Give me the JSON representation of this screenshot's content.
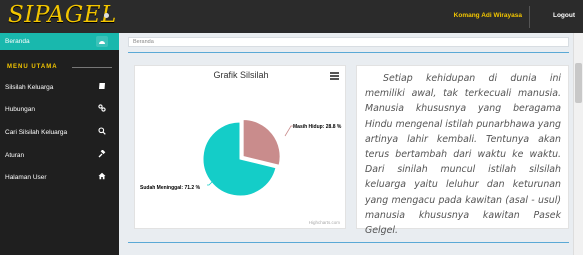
{
  "header": {
    "brand": "SIPAGEL",
    "user_name": "Komang Adi Wirayasa",
    "logout_label": "Logout"
  },
  "sidebar": {
    "active_item": {
      "label": "Beranda",
      "icon": "dashboard-icon"
    },
    "menu_title": "MENU UTAMA",
    "items": [
      {
        "label": "Silsilah Keluarga",
        "icon": "book-icon"
      },
      {
        "label": "Hubungan",
        "icon": "link-icon"
      },
      {
        "label": "Cari Silsilah Keluarga",
        "icon": "search-icon"
      },
      {
        "label": "Aturan",
        "icon": "gavel-icon"
      },
      {
        "label": "Halaman User",
        "icon": "home-icon"
      }
    ]
  },
  "breadcrumb": "Beranda",
  "chart_data": {
    "type": "pie",
    "title": "Grafik Silsilah",
    "series": [
      {
        "name": "Masih Hidup",
        "value": 28.8,
        "label": "Masih Hidup: 28.8 %",
        "color": "#c98c8c"
      },
      {
        "name": "Sudah Meninggal",
        "value": 71.2,
        "label": "Sudah Meninggal: 71.2 %",
        "color": "#14cdc8"
      }
    ],
    "credit": "Highcharts.com"
  },
  "intro_text": "Setiap kehidupan di dunia ini memiliki awal, tak terkecuali manusia. Manusia khususnya yang beragama Hindu mengenal istilah punarbhawa yang artinya lahir kembali. Tentunya akan terus bertambah dari waktu ke waktu. Dari sinilah muncul istilah silsilah keluarga yaitu leluhur dan keturunan yang mengacu pada kawitan (asal - usul) manusia khususnya kawitan Pasek Gelgel.",
  "colors": {
    "accent": "#19b8ad",
    "brand": "#f2c500",
    "topbar": "#2b2b2b",
    "sidebar": "#1f1f1f"
  }
}
